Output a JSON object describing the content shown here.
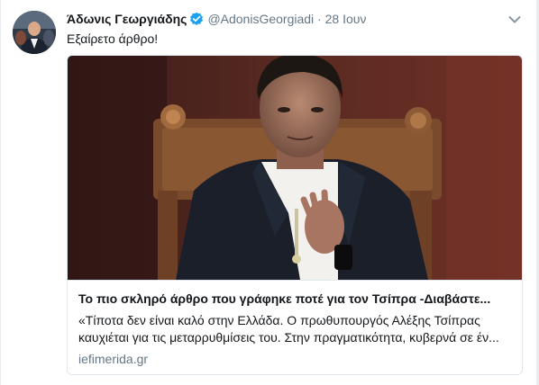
{
  "tweet": {
    "author_name": "Άδωνις Γεωργιάδης",
    "handle": "@AdonisGeorgiadi",
    "separator": "·",
    "date": "28 Ιουν",
    "verified": true,
    "text": "Εξαίρετο άρθρο!"
  },
  "card": {
    "title": "Το πιο σκληρό άρθρο που γράφηκε ποτέ για τον Τσίπρα -Διαβάστε...",
    "description": "«Τίποτα δεν είναι καλό στην Ελλάδα. Ο πρωθυπουργός Αλέξης Τσίπρας καυχιέται για τις μεταρρυθμίσεις του. Στην πραγματικότητα, κυβερνά σε έν...",
    "domain": "iefimerida.gr"
  },
  "icons": {
    "verified": "verified-badge-icon",
    "caret": "chevron-down-icon"
  },
  "colors": {
    "accent": "#1da1f2",
    "secondary_text": "#657786",
    "primary_text": "#14171a",
    "border": "#e1e8ed",
    "page_bg": "#e6ecf0"
  }
}
